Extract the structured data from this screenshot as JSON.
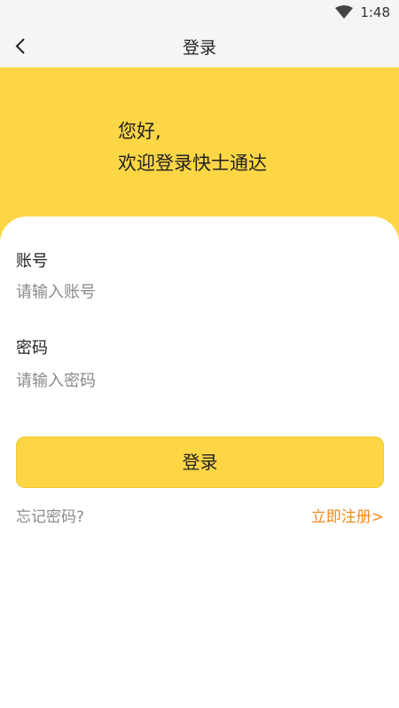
{
  "status_bar": {
    "time": "1:48",
    "icon": "wifi-icon"
  },
  "nav": {
    "title": "登录",
    "back_icon": "chevron-left-icon"
  },
  "hero": {
    "line1": "您好,",
    "line2": "欢迎登录快士通达",
    "background": "#fdd645"
  },
  "form": {
    "account_label": "账号",
    "account_placeholder": "请输入账号",
    "account_value": "",
    "password_label": "密码",
    "password_placeholder": "请输入密码",
    "password_value": "",
    "login_label": "登录",
    "forgot_label": "忘记密码?",
    "register_label": "立即注册>"
  },
  "colors": {
    "accent": "#fdd645",
    "link": "#f08a1c",
    "muted": "#8a8a8a"
  }
}
